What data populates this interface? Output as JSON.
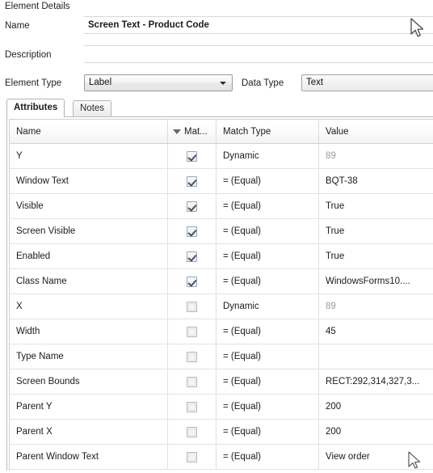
{
  "panel": {
    "title": "Element Details"
  },
  "form": {
    "name_label": "Name",
    "name_value": "Screen Text - Product Code",
    "description_label": "Description",
    "description_value": "",
    "element_type_label": "Element Type",
    "element_type_value": "Label",
    "data_type_label": "Data Type",
    "data_type_value": "Text"
  },
  "tabs": [
    {
      "label": "Attributes",
      "active": true
    },
    {
      "label": "Notes",
      "active": false
    }
  ],
  "grid": {
    "columns": [
      "Name",
      "Mat...",
      "Match Type",
      "Value"
    ],
    "sorted_column": "Mat...",
    "rows": [
      {
        "name": "Y",
        "match": true,
        "match_type": "Dynamic",
        "value": "89",
        "value_muted": true
      },
      {
        "name": "Window Text",
        "match": true,
        "match_type": "=  (Equal)",
        "value": "BQT-38",
        "value_muted": false
      },
      {
        "name": "Visible",
        "match": true,
        "match_type": "=  (Equal)",
        "value": "True",
        "value_muted": false
      },
      {
        "name": "Screen Visible",
        "match": true,
        "match_type": "=  (Equal)",
        "value": "True",
        "value_muted": false
      },
      {
        "name": "Enabled",
        "match": true,
        "match_type": "=  (Equal)",
        "value": "True",
        "value_muted": false
      },
      {
        "name": "Class Name",
        "match": true,
        "match_type": "=  (Equal)",
        "value": "WindowsForms10....",
        "value_muted": false
      },
      {
        "name": "X",
        "match": false,
        "match_type": "Dynamic",
        "value": "89",
        "value_muted": true
      },
      {
        "name": "Width",
        "match": false,
        "match_type": "=  (Equal)",
        "value": "45",
        "value_muted": false
      },
      {
        "name": "Type Name",
        "match": false,
        "match_type": "=  (Equal)",
        "value": "",
        "value_muted": false
      },
      {
        "name": "Screen Bounds",
        "match": false,
        "match_type": "=  (Equal)",
        "value": "RECT:292,314,327,3...",
        "value_muted": false
      },
      {
        "name": "Parent Y",
        "match": false,
        "match_type": "=  (Equal)",
        "value": "200",
        "value_muted": false
      },
      {
        "name": "Parent X",
        "match": false,
        "match_type": "=  (Equal)",
        "value": "200",
        "value_muted": false
      },
      {
        "name": "Parent Window Text",
        "match": false,
        "match_type": "=  (Equal)",
        "value": "View order",
        "value_muted": false
      }
    ]
  },
  "colors": {
    "checkbox_check": "#43536b",
    "sort_triangle": "#5f6b78",
    "muted_text": "#9a9a9a",
    "grid_border": "#bcbcbc"
  }
}
